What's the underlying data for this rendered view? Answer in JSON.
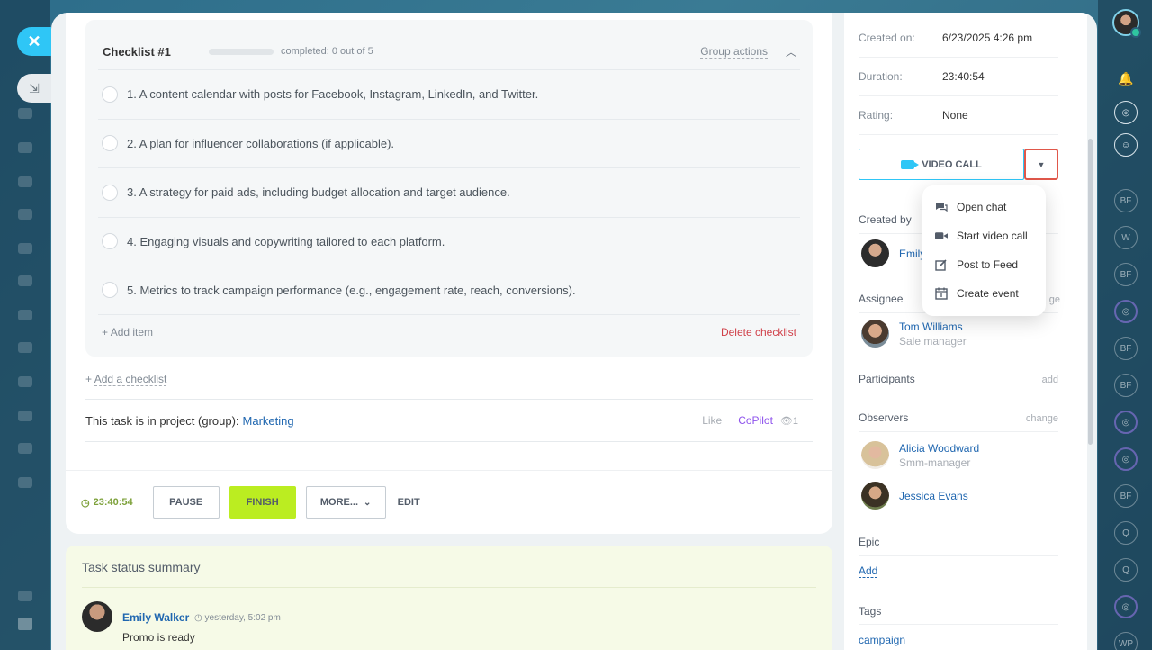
{
  "window": {
    "close_glyph": "✕",
    "collapse_glyph": "⇲"
  },
  "checklist": {
    "title": "Checklist #1",
    "progress": 0,
    "completed_text": "completed: 0 out of 5",
    "group_actions": "Group actions",
    "items": [
      "1. A content calendar with posts for Facebook, Instagram, LinkedIn, and Twitter.",
      "2. A plan for influencer collaborations (if applicable).",
      "3. A strategy for paid ads, including budget allocation and target audience.",
      "4. Engaging visuals and copywriting tailored to each platform.",
      "5. Metrics to track campaign performance (e.g., engagement rate, reach, conversions)."
    ],
    "add_item_prefix": "+ ",
    "add_item": "Add item",
    "delete": "Delete checklist"
  },
  "add_checklist_prefix": "+ ",
  "add_checklist": "Add a checklist",
  "project": {
    "label": "This task is in project (group):",
    "name": "Marketing",
    "like": "Like",
    "copilot": "CoPilot",
    "views": "1"
  },
  "actions": {
    "timer": "23:40:54",
    "pause": "PAUSE",
    "finish": "FINISH",
    "more": "MORE...",
    "edit": "EDIT"
  },
  "summary": {
    "title": "Task status summary",
    "author": "Emily Walker",
    "time": "yesterday, 5:02 pm",
    "text": "Promo is ready"
  },
  "side": {
    "created_on_label": "Created on:",
    "created_on": "6/23/2025 4:26 pm",
    "duration_label": "Duration:",
    "duration": "23:40:54",
    "rating_label": "Rating:",
    "rating": "None",
    "video_call": "VIDEO CALL",
    "created_by_label": "Created by",
    "created_by_name": "Emily",
    "assignee_label": "Assignee",
    "assignee_change": "ge",
    "assignee_name": "Tom Williams",
    "assignee_role": "Sale manager",
    "participants_label": "Participants",
    "participants_add": "add",
    "observers_label": "Observers",
    "observers_change": "change",
    "observers": [
      {
        "name": "Alicia Woodward",
        "role": "Smm-manager"
      },
      {
        "name": "Jessica Evans",
        "role": ""
      }
    ],
    "epic_label": "Epic",
    "epic_add": "Add",
    "tags_label": "Tags",
    "tag": "campaign"
  },
  "menu": {
    "items": [
      {
        "label": "Open chat",
        "icon": "chat-icon"
      },
      {
        "label": "Start video call",
        "icon": "video-camera-icon"
      },
      {
        "label": "Post to Feed",
        "icon": "edit-post-icon"
      },
      {
        "label": "Create event",
        "icon": "calendar-icon"
      }
    ]
  },
  "rail": {
    "initials": [
      "BF",
      "W",
      "BF",
      "BF",
      "BF",
      "BF",
      "Q",
      "Q",
      "WP"
    ]
  },
  "colors": {
    "accent": "#2fc6f6",
    "finish": "#bbed21",
    "link": "#2067b0",
    "danger": "#d0414a",
    "copilot": "#8e52ec",
    "highlight": "#e0574a"
  }
}
